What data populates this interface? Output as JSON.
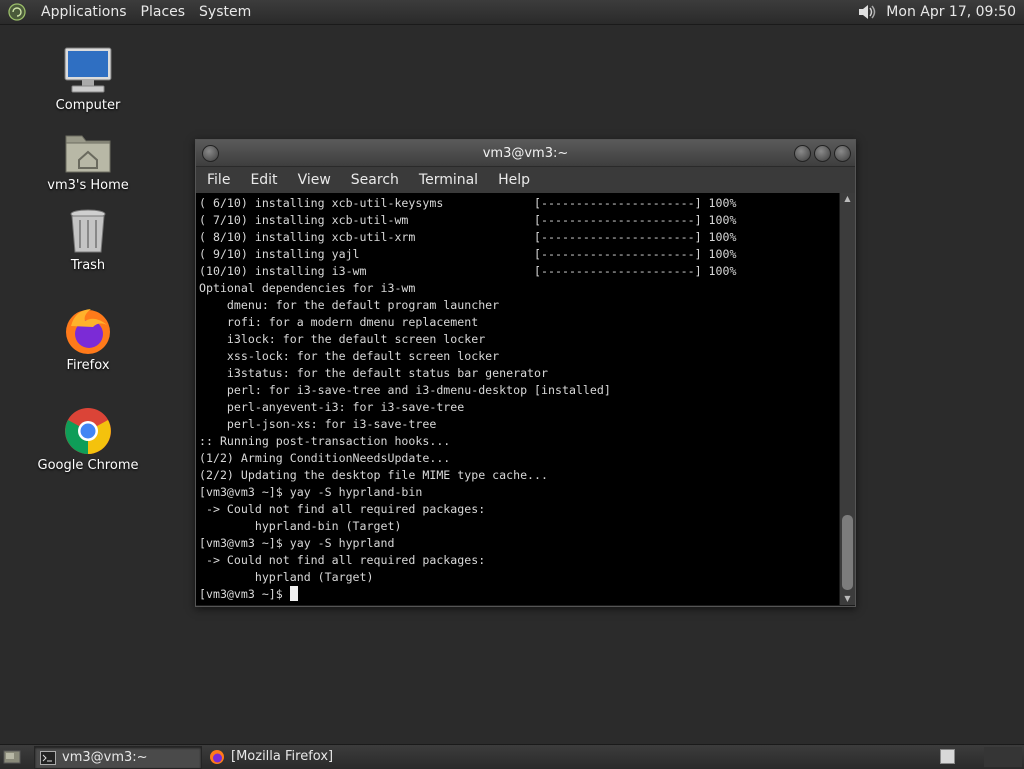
{
  "top_panel": {
    "menus": [
      "Applications",
      "Places",
      "System"
    ],
    "clock": "Mon Apr 17, 09:50"
  },
  "desktop_icons": [
    {
      "label": "Computer",
      "icon": "computer-icon"
    },
    {
      "label": "vm3's Home",
      "icon": "home-folder-icon"
    },
    {
      "label": "Trash",
      "icon": "trash-icon"
    },
    {
      "label": "Firefox",
      "icon": "firefox-icon"
    },
    {
      "label": "Google Chrome",
      "icon": "chrome-icon"
    }
  ],
  "terminal": {
    "title": "vm3@vm3:~",
    "menus": [
      "File",
      "Edit",
      "View",
      "Search",
      "Terminal",
      "Help"
    ],
    "lines": [
      "( 6/10) installing xcb-util-keysyms             [----------------------] 100%",
      "( 7/10) installing xcb-util-wm                  [----------------------] 100%",
      "( 8/10) installing xcb-util-xrm                 [----------------------] 100%",
      "( 9/10) installing yajl                         [----------------------] 100%",
      "(10/10) installing i3-wm                        [----------------------] 100%",
      "Optional dependencies for i3-wm",
      "    dmenu: for the default program launcher",
      "    rofi: for a modern dmenu replacement",
      "    i3lock: for the default screen locker",
      "    xss-lock: for the default screen locker",
      "    i3status: for the default status bar generator",
      "    perl: for i3-save-tree and i3-dmenu-desktop [installed]",
      "    perl-anyevent-i3: for i3-save-tree",
      "    perl-json-xs: for i3-save-tree",
      ":: Running post-transaction hooks...",
      "(1/2) Arming ConditionNeedsUpdate...",
      "(2/2) Updating the desktop file MIME type cache...",
      "[vm3@vm3 ~]$ yay -S hyprland-bin",
      " -> Could not find all required packages:",
      "        hyprland-bin (Target)",
      "[vm3@vm3 ~]$ yay -S hyprland",
      " -> Could not find all required packages:",
      "        hyprland (Target)"
    ],
    "prompt": "[vm3@vm3 ~]$ "
  },
  "taskbar": {
    "tasks": [
      {
        "label": "vm3@vm3:~",
        "icon": "terminal-icon",
        "active": true
      },
      {
        "label": "[Mozilla Firefox]",
        "icon": "firefox-icon",
        "active": false
      }
    ]
  }
}
